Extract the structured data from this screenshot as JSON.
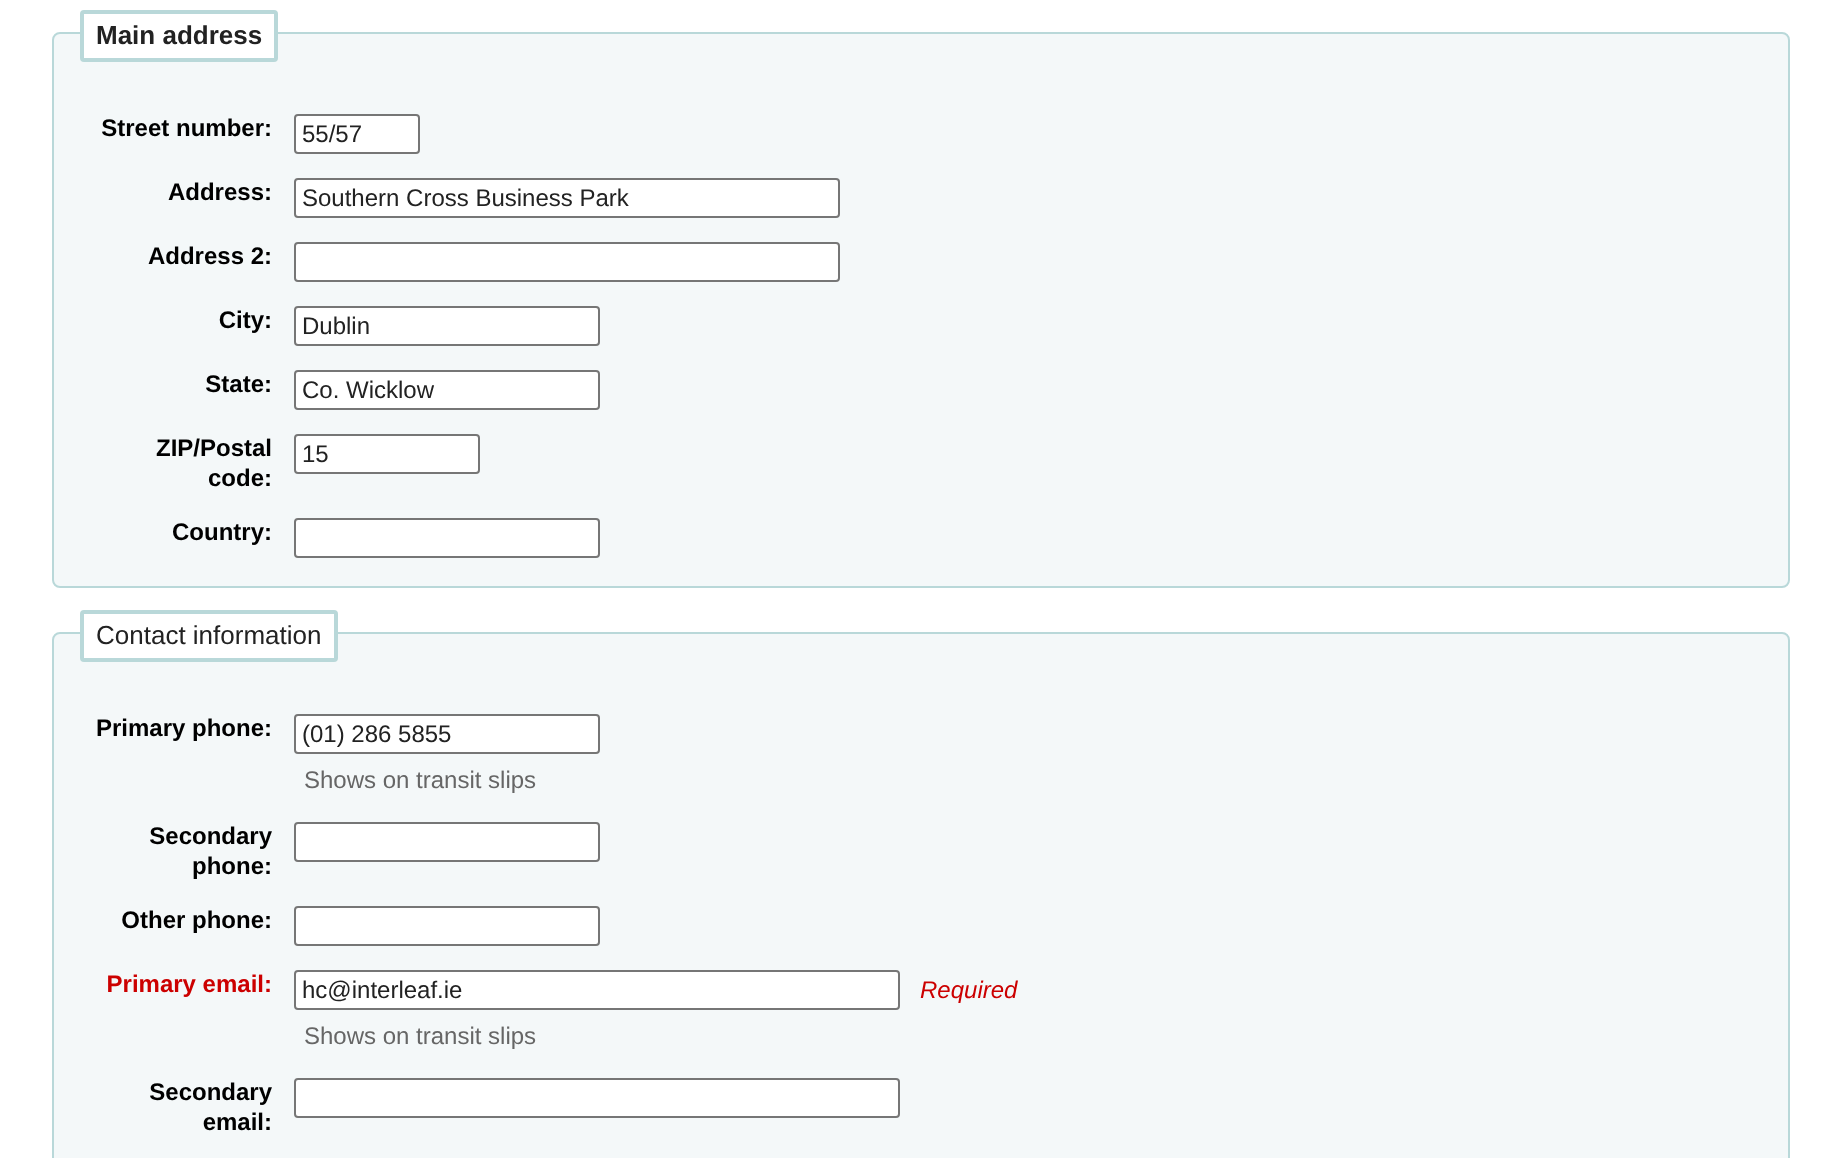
{
  "sections": [
    {
      "legend": "Main address",
      "bold": true,
      "fields": [
        {
          "label": "Street number:",
          "value": "55/57",
          "kind": "short",
          "required": false
        },
        {
          "label": "Address:",
          "value": "Southern Cross Business Park",
          "kind": "long",
          "required": false
        },
        {
          "label": "Address 2:",
          "kind": "long",
          "required": false
        },
        {
          "label": "City:",
          "value": "Dublin",
          "kind": "medium",
          "required": false
        },
        {
          "label": "State:",
          "value": "Co. Wicklow",
          "kind": "medium",
          "required": false
        },
        {
          "label": "ZIP/Postal code:",
          "value": "15",
          "kind": "zip",
          "required": false
        },
        {
          "label": "Country:",
          "kind": "medium",
          "required": false
        }
      ]
    },
    {
      "legend": "Contact information",
      "bold": false,
      "fields": [
        {
          "label": "Primary phone:",
          "value": "(01) 286 5855",
          "kind": "medium",
          "required": false,
          "hint": "Shows on transit slips"
        },
        {
          "label": "Secondary phone:",
          "kind": "medium",
          "required": false
        },
        {
          "label": "Other phone:",
          "kind": "medium",
          "required": false
        },
        {
          "label": "Primary email:",
          "value": "hc@interleaf.ie",
          "kind": "email",
          "required": true,
          "required_note": "Required",
          "hint": "Shows on transit slips"
        },
        {
          "label": "Secondary email:",
          "kind": "email",
          "required": false
        }
      ]
    }
  ]
}
